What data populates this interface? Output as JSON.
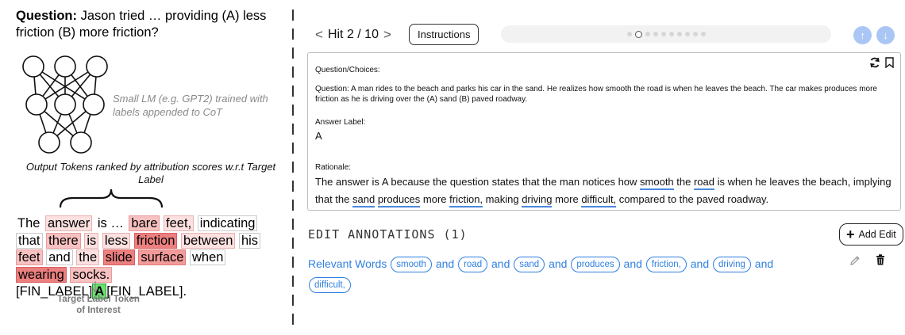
{
  "figure": {
    "question_bold": "Question:",
    "question_text": " Jason tried … providing (A) less friction (B) more friction?",
    "model_caption": "Small LM (e.g. GPT2) trained with labels appended to CoT",
    "output_caption": "Output Tokens ranked by attribution scores w.r.t Target Label",
    "tokens": [
      {
        "text": "The",
        "level": "plain"
      },
      {
        "text": "answer",
        "level": "t1"
      },
      {
        "text": "is …",
        "level": "plain"
      },
      {
        "text": "bare",
        "level": "t2"
      },
      {
        "text": "feet,",
        "level": "t1"
      },
      {
        "text": "indicating",
        "level": "t0"
      },
      {
        "text": "that",
        "level": "t0"
      },
      {
        "text": "there",
        "level": "t2"
      },
      {
        "text": "is",
        "level": "t1"
      },
      {
        "text": "less",
        "level": "t1"
      },
      {
        "text": "friction",
        "level": "t4"
      },
      {
        "text": "between",
        "level": "t1"
      },
      {
        "text": "his",
        "level": "t0"
      },
      {
        "text": "feet",
        "level": "t2"
      },
      {
        "text": "and",
        "level": "t0"
      },
      {
        "text": "the",
        "level": "t1"
      },
      {
        "text": "slide",
        "level": "t4"
      },
      {
        "text": "surface",
        "level": "t3"
      },
      {
        "text": "when",
        "level": "t0"
      },
      {
        "text": "wearing",
        "level": "t4"
      },
      {
        "text": "socks.",
        "level": "t2"
      }
    ],
    "label_tag_open": "[FIN_LABEL]",
    "target_token": "A",
    "label_tag_close": "[FIN_LABEL].",
    "target_caption": "Target Label Token of Interest"
  },
  "ui": {
    "hit_label": "Hit 2 / 10",
    "prev_symbol": "<",
    "next_symbol": ">",
    "instructions_label": "Instructions",
    "progress": {
      "total": 10,
      "current": 2
    },
    "up_symbol": "↑",
    "down_symbol": "↓",
    "qbox": {
      "title": "Question/Choices:",
      "question": "Question: A man rides to the beach and parks his car in the sand. He realizes how smooth the road is when he leaves the beach. The car makes produces more friction as he is driving over the (A) sand (B) paved roadway.",
      "answer_label_title": "Answer Label:",
      "answer_label": "A",
      "rationale_title": "Rationale:",
      "rationale_parts": [
        {
          "text": "The answer is A because the question states that the man notices how ",
          "u": false
        },
        {
          "text": "smooth",
          "u": true
        },
        {
          "text": " the ",
          "u": false
        },
        {
          "text": "road",
          "u": true
        },
        {
          "text": " is when he leaves the beach, implying that the ",
          "u": false
        },
        {
          "text": "sand",
          "u": true
        },
        {
          "text": " ",
          "u": false
        },
        {
          "text": "produces",
          "u": true
        },
        {
          "text": " more ",
          "u": false
        },
        {
          "text": "friction,",
          "u": true
        },
        {
          "text": " making ",
          "u": false
        },
        {
          "text": "driving",
          "u": true
        },
        {
          "text": " more ",
          "u": false
        },
        {
          "text": "difficult,",
          "u": true
        },
        {
          "text": " compared to the paved roadway.",
          "u": false
        }
      ]
    },
    "edit_title": "EDIT ANNOTATIONS (1)",
    "add_edit_label": "Add Edit",
    "annotation": {
      "label": "Relevant Words",
      "connector": "and",
      "words": [
        "smooth",
        "road",
        "sand",
        "produces",
        "friction,",
        "driving",
        "difficult,"
      ]
    },
    "colors": {
      "accent": "#2f7fe0",
      "underline": "#4a89dc",
      "arrow_btn": "#a9c6f5"
    }
  }
}
